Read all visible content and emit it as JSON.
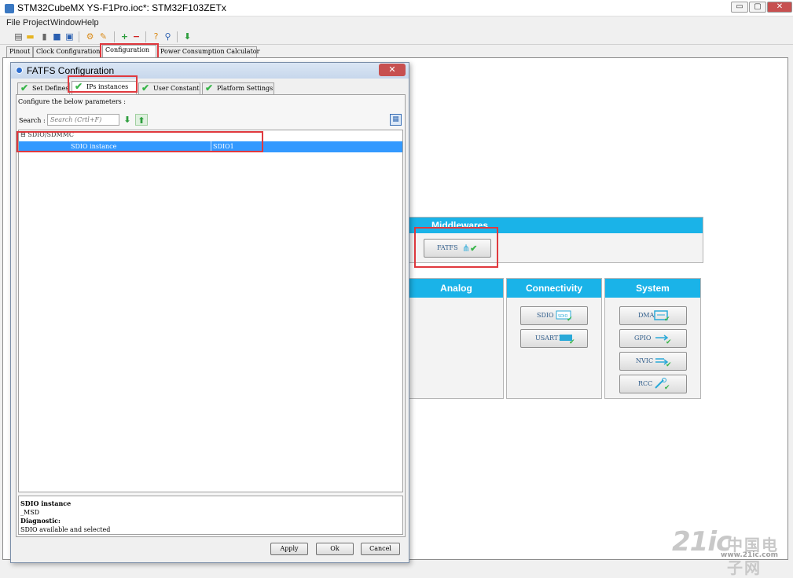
{
  "app": {
    "title": "STM32CubeMX YS-F1Pro.ioc*: STM32F103ZETx",
    "window_buttons": [
      "▭",
      "▢",
      "✕"
    ]
  },
  "menu": [
    "File",
    "Project",
    "Window",
    "Help"
  ],
  "toolbar": {
    "icons": [
      "new-project-icon",
      "open-icon",
      "copy-icon",
      "save-icon",
      "save-as-icon",
      "generate-icon",
      "report-icon",
      "add-icon",
      "remove-icon",
      "help-icon",
      "about-icon",
      "download-icon"
    ]
  },
  "main_tabs": [
    "Pinout",
    "Clock Configuration",
    "Configuration",
    "Power Consumption Calculator"
  ],
  "categories": {
    "middlewares": {
      "title": "Middlewares",
      "items": [
        "FATFS"
      ]
    },
    "analog": {
      "title": "Analog"
    },
    "connectivity": {
      "title": "Connectivity",
      "items": [
        "SDIO",
        "USART1"
      ]
    },
    "system": {
      "title": "System",
      "items": [
        "DMA",
        "GPIO",
        "NVIC",
        "RCC"
      ]
    }
  },
  "dialog": {
    "title": "FATFS Configuration",
    "close": "✕",
    "tabs": [
      "Set Defines",
      "IPs instances",
      "User Constants",
      "Platform Settings"
    ],
    "instructions": "Configure the below parameters :",
    "search_label": "Search :",
    "search_placeholder": "Search (Crtl+F)",
    "tree_group": "⊟ SDIO/SDMMC",
    "row": {
      "name": "SDIO instance",
      "value": "SDIO1"
    },
    "description": {
      "title": "SDIO instance",
      "subtitle": "_MSD",
      "diag_label": "Diagnostic:",
      "diag_text": "SDIO available and selected"
    },
    "buttons": {
      "apply": "Apply",
      "ok": "Ok",
      "cancel": "Cancel"
    }
  },
  "watermark": {
    "logo": "21ic",
    "cn": "中国电子网",
    "url": "www.21ic.com"
  },
  "colors": {
    "accent": "#1ab3e8",
    "selection": "#3399ff",
    "highlight": "#e0393e",
    "check": "#39b54a"
  }
}
